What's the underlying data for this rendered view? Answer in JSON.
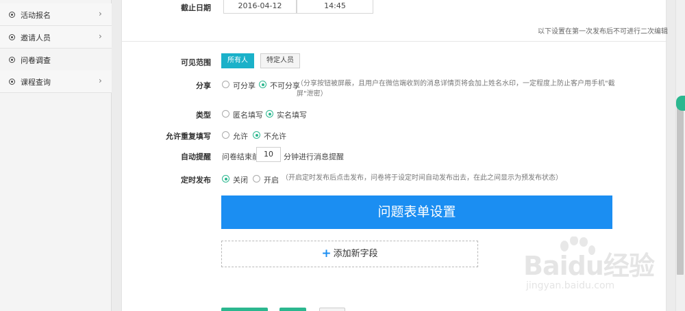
{
  "sidebar": {
    "items": [
      {
        "label": "活动报名",
        "active": false
      },
      {
        "label": "邀请人员",
        "active": false
      },
      {
        "label": "问卷调查",
        "active": true
      },
      {
        "label": "课程查询",
        "active": false
      }
    ]
  },
  "deadline": {
    "label": "截止日期",
    "date": "2016-04-12",
    "time": "14:45"
  },
  "notice": "以下设置在第一次发布后不可进行二次编辑",
  "visibility": {
    "label": "可见范围",
    "all_label": "所有人",
    "specific_label": "特定人员"
  },
  "share": {
    "label": "分享",
    "opt_yes": "可分享",
    "opt_no": "不可分享",
    "hint_line1": "（分享按钮被屏蔽，且用户在微信端收到的消息详情页将会加上姓名水印，一定程度上防止客户用手机\"截",
    "hint_line2": "屏\"泄密）",
    "selected": "opt_no"
  },
  "type": {
    "label": "类型",
    "opt_anon": "匿名填写",
    "opt_real": "实名填写",
    "selected": "opt_real"
  },
  "repeat": {
    "label": "允许重复填写",
    "opt_allow": "允许",
    "opt_deny": "不允许",
    "selected": "opt_deny"
  },
  "reminder": {
    "label": "自动提醒",
    "prefix": "问卷结束前",
    "value": "10",
    "suffix": "分钟进行消息提醒"
  },
  "schedule": {
    "label": "定时发布",
    "opt_off": "关闭",
    "opt_on": "开启",
    "hint": "（开启定时发布后点击发布，问卷将于设定时间自动发布出去，在此之间显示为预发布状态）",
    "selected": "opt_off"
  },
  "form_settings_label": "问题表单设置",
  "add_field_label": "添加新字段",
  "watermark": {
    "logo": "Baidu经验",
    "site": "jingyan.baidu.com"
  },
  "colors": {
    "accent_teal": "#1ab1c9",
    "primary_blue": "#1b8ef2",
    "radio_green": "#2bb78f"
  }
}
